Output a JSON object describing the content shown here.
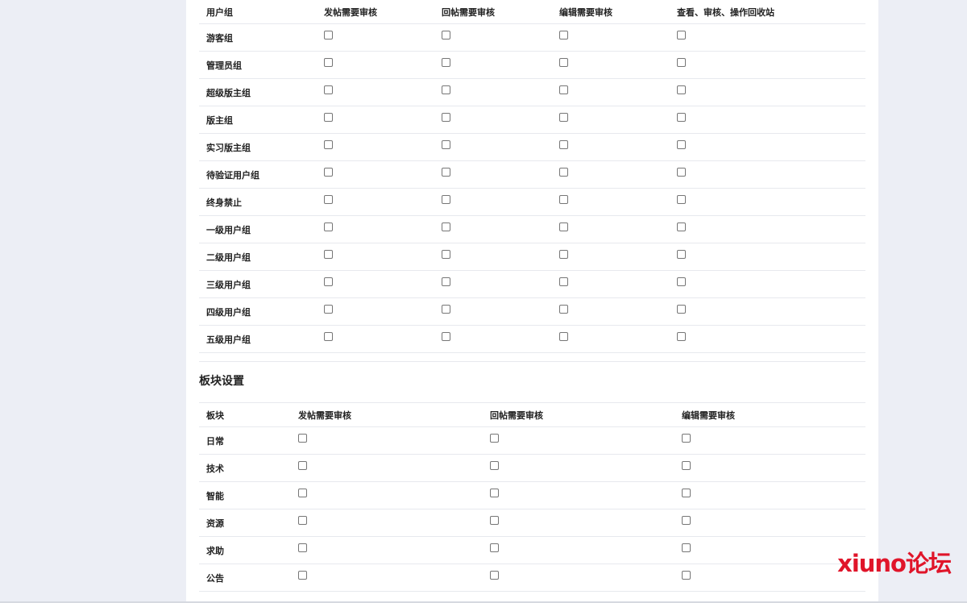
{
  "user_groups": {
    "headers": [
      "用户组",
      "发帖需要审核",
      "回帖需要审核",
      "编辑需要审核",
      "查看、审核、操作回收站"
    ],
    "rows": [
      "游客组",
      "管理员组",
      "超级版主组",
      "版主组",
      "实习版主组",
      "待验证用户组",
      "终身禁止",
      "一级用户组",
      "二级用户组",
      "三级用户组",
      "四级用户组",
      "五级用户组"
    ]
  },
  "forum_settings": {
    "title": "板块设置",
    "headers": [
      "板块",
      "发帖需要审核",
      "回帖需要审核",
      "编辑需要审核"
    ],
    "rows": [
      "日常",
      "技术",
      "智能",
      "资源",
      "求助",
      "公告"
    ]
  },
  "watermark": "xiuno论坛"
}
